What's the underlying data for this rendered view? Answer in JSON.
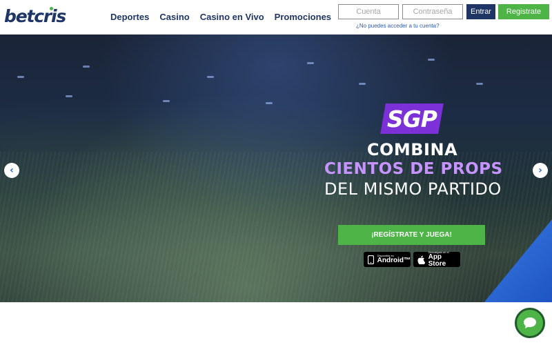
{
  "header": {
    "logo": "betcris",
    "nav": [
      "Deportes",
      "Casino",
      "Casino en Vivo",
      "Promociones"
    ],
    "login": {
      "account_placeholder": "Cuenta",
      "password_placeholder": "Contraseña",
      "login_label": "Entrar",
      "register_label": "Registrate",
      "forgot_link": "¿No puedes acceder a tu cuenta?"
    }
  },
  "hero": {
    "badge": "SGP",
    "headline_1": "COMBINA",
    "headline_2": "CIENTOS DE PROPS",
    "headline_3": "DEL MISMO PARTIDO",
    "cta_label": "¡REGÍSTRATE Y JUEGA!",
    "stores": {
      "android_small": "Disponible en",
      "android_big": "Android™",
      "apple_small": "Descárgalo en el",
      "apple_big": "App Store"
    },
    "prev_icon": "chevron-left-icon",
    "next_icon": "chevron-right-icon"
  },
  "chat": {
    "icon": "chat-bubble-icon"
  },
  "colors": {
    "brand_navy": "#1f3566",
    "brand_green": "#4eb447",
    "sgp_purple": "#7b30d8",
    "props_lavender": "#c794ff"
  }
}
